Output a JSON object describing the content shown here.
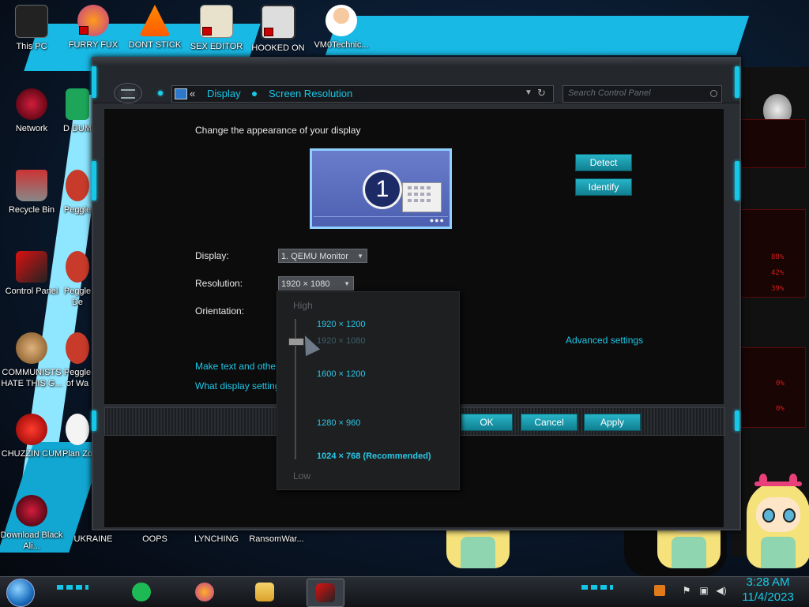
{
  "desktop": {
    "icons_top": [
      {
        "label": "This PC"
      },
      {
        "label": "FURRY FUX"
      },
      {
        "label": "DONT STICK"
      },
      {
        "label": "SEX EDITOR"
      },
      {
        "label": "HOOKED ON"
      },
      {
        "label": "VM0Technic..."
      }
    ],
    "icons_left": [
      {
        "label": "Network"
      },
      {
        "label": "Recycle Bin"
      },
      {
        "label": "Control Panel"
      },
      {
        "label": "COMMUNISTS HATE THIS G..."
      },
      {
        "label": "CHUZZIN CUM"
      },
      {
        "label": "Download Black Ali..."
      }
    ],
    "icons_col2": [
      {
        "label": "D DUM"
      },
      {
        "label": "Peggle"
      },
      {
        "label": "Peggle De"
      },
      {
        "label": "Peggle of Wa"
      },
      {
        "label": "Plan Zo"
      }
    ],
    "icons_bottom": [
      {
        "label": "UKRAINE"
      },
      {
        "label": "OOPS"
      },
      {
        "label": "LYNCHING"
      },
      {
        "label": "RansomWar..."
      }
    ],
    "hud_readouts": [
      "88%",
      "42%",
      "39%",
      "0%",
      "0%"
    ]
  },
  "window": {
    "breadcrumb": [
      "Display",
      "Screen Resolution"
    ],
    "search_placeholder": "Search Control Panel",
    "heading": "Change the appearance of your display",
    "monitor_number": "1",
    "detect_label": "Detect",
    "identify_label": "Identify",
    "display_label": "Display:",
    "display_value": "1. QEMU Monitor",
    "resolution_label": "Resolution:",
    "resolution_value": "1920 × 1080",
    "orientation_label": "Orientation:",
    "advanced_link": "Advanced settings",
    "link1": "Make text and other",
    "link2": "What display setting",
    "ok_label": "OK",
    "cancel_label": "Cancel",
    "apply_label": "Apply"
  },
  "resolution_popup": {
    "high_label": "High",
    "low_label": "Low",
    "options": [
      {
        "label": "1920 × 1200",
        "state": "normal"
      },
      {
        "label": "1920 × 1080",
        "state": "current"
      },
      {
        "label": "1600 × 1200",
        "state": "normal"
      },
      {
        "label": "1280 × 960",
        "state": "normal"
      },
      {
        "label": "1024 × 768 (Recommended)",
        "state": "recommended"
      }
    ]
  },
  "taskbar": {
    "apps": [
      {
        "icon": "spotify-like-icon"
      },
      {
        "icon": "firefox-icon"
      },
      {
        "icon": "file-explorer-icon"
      },
      {
        "icon": "display-settings-icon",
        "active": true
      }
    ],
    "clock_time": "3:28 AM",
    "clock_date": "11/4/2023"
  },
  "colors": {
    "accent": "#19c8e6",
    "button": "#1aa3b6",
    "window_bg": "#2b2e33",
    "content_bg": "#0c0c0c"
  }
}
